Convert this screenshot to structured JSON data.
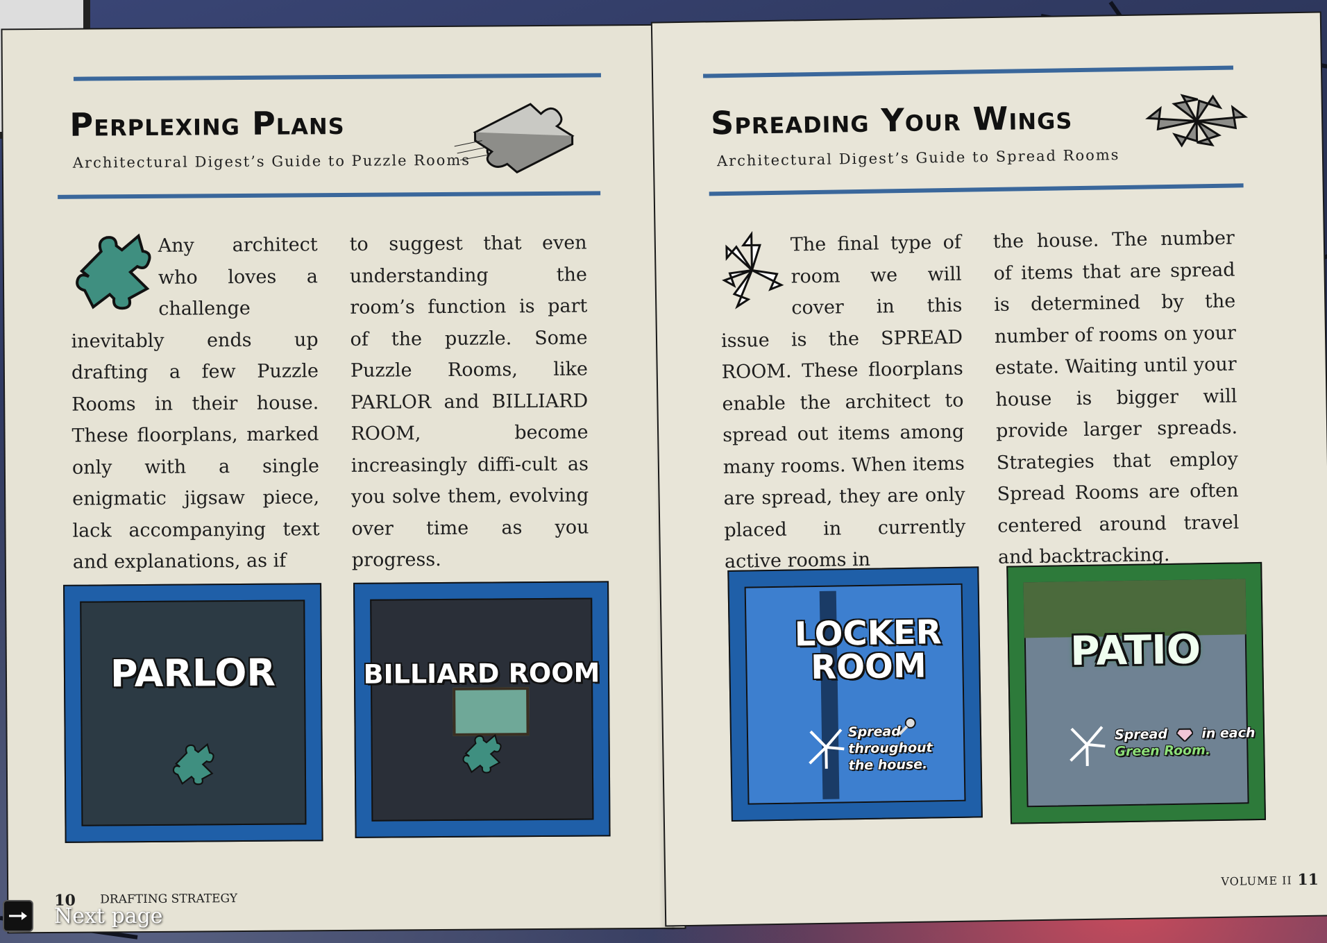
{
  "left_page": {
    "title": "Perplexing Plans",
    "subtitle": "Architectural Digest’s Guide to Puzzle Rooms",
    "title_icon": "jigsaw-piece-icon",
    "dropcap_icon": "jigsaw-piece-icon",
    "column_1": "Any architect who loves a challenge inevitably ends up drafting a few Puzzle Rooms in their house. These floorplans, marked only with a single enigmatic jigsaw piece, lack accompanying text and explanations, as if",
    "column_2": "to suggest that even understanding the room’s function is part of the puzzle. Some Puzzle Rooms, like PARLOR and BILLIARD ROOM, become increasingly diffi-cult as you solve them, evolving over time as you progress.",
    "rooms": [
      {
        "label": "PARLOR",
        "frame_color": "#1f5fa8",
        "floor_color": "#2c3a44"
      },
      {
        "label": "BILLIARD ROOM",
        "frame_color": "#1f5fa8",
        "floor_color": "#2a2f38"
      }
    ],
    "page_number": "10",
    "section": "DRAFTING STRATEGY"
  },
  "right_page": {
    "title": "Spreading Your Wings",
    "subtitle": "Architectural Digest’s Guide to Spread Rooms",
    "title_icon": "spread-arrows-icon",
    "dropcap_icon": "spread-arrows-icon",
    "column_1": "The final type of room we will cover in this issue is the SPREAD ROOM. These floorplans enable the architect to spread out items among many rooms. When items are spread, they are only placed in currently active rooms in",
    "column_2": "the house. The number of items that are spread is determined by the number of rooms on your estate. Waiting until your house is bigger will provide larger spreads. Strategies that employ Spread Rooms are often centered around travel and backtracking.",
    "rooms": [
      {
        "label_line_1": "LOCKER",
        "label_line_2": "ROOM",
        "note_line_1": "Spread",
        "note_line_2": "throughout",
        "note_line_3": "the house.",
        "note_icon": "key-icon",
        "frame_color": "#1f5fa8",
        "floor_color": "#3d7fcf"
      },
      {
        "label": "PATIO",
        "note_line_1": "Spread",
        "note_line_1b": "in each",
        "note_line_2": "Green Room.",
        "note_icon": "gem-icon",
        "frame_color": "#2d7a3a",
        "floor_color": "#6f8293"
      }
    ],
    "volume": "VOLUME II",
    "page_number": "11"
  },
  "prompt": {
    "label": "Next page",
    "icon": "next-page-key-icon"
  },
  "colors": {
    "paper": "#e6e3d5",
    "rule_blue": "#3a679b",
    "ink": "#1e1e1e",
    "puzzle_teal": "#3f8f80"
  }
}
